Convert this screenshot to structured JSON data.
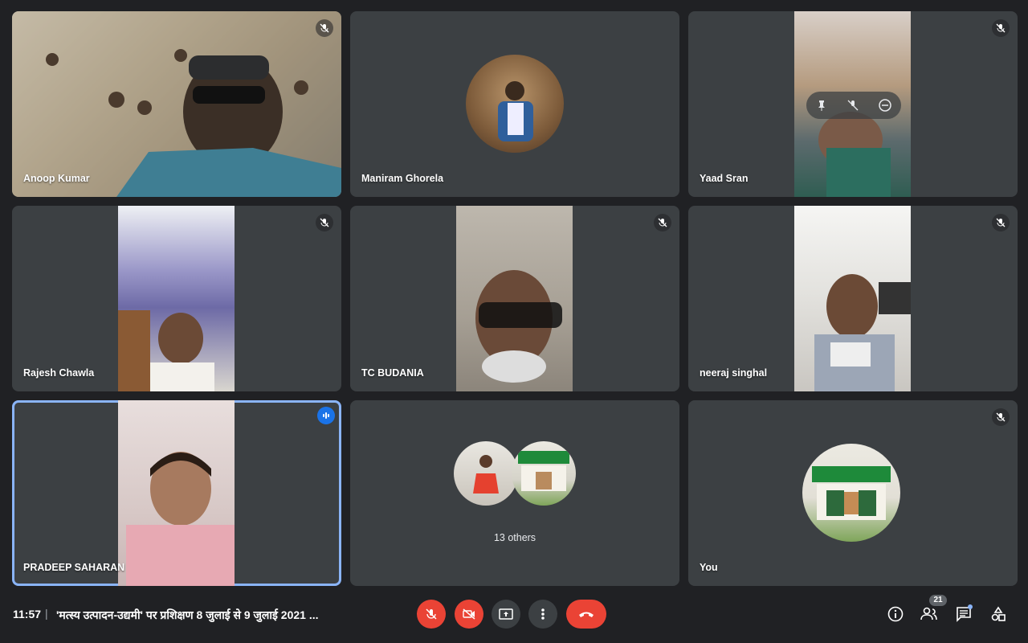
{
  "participants": [
    {
      "name": "Anoop Kumar",
      "muted": true
    },
    {
      "name": "Maniram Ghorela",
      "muted": false
    },
    {
      "name": "Yaad Sran",
      "muted": true
    },
    {
      "name": "Rajesh Chawla",
      "muted": true
    },
    {
      "name": "TC BUDANIA",
      "muted": true
    },
    {
      "name": "neeraj singhal",
      "muted": true
    },
    {
      "name": "PRADEEP SAHARAN",
      "muted": false,
      "speaking": true
    },
    {
      "name": "13 others"
    },
    {
      "name": "You",
      "muted": true
    }
  ],
  "footer": {
    "time": "11:57",
    "separator": "|",
    "title": "'मत्स्य उत्पादन-उद्यमी' पर प्रशिक्षण 8 जुलाई से 9 जुलाई 2021 ...",
    "participant_count": "21"
  },
  "icons": {
    "mic": "mic-off-icon",
    "camera": "camera-off-icon",
    "present": "present-screen-icon",
    "more": "more-options-icon",
    "end": "end-call-icon",
    "info": "info-icon",
    "people": "people-icon",
    "chat": "chat-icon",
    "activities": "activities-icon"
  },
  "colors": {
    "background": "#202124",
    "tile": "#3c4043",
    "red": "#ea4335",
    "speaking_border": "#8ab4f8",
    "speaking_badge": "#1a73e8"
  }
}
